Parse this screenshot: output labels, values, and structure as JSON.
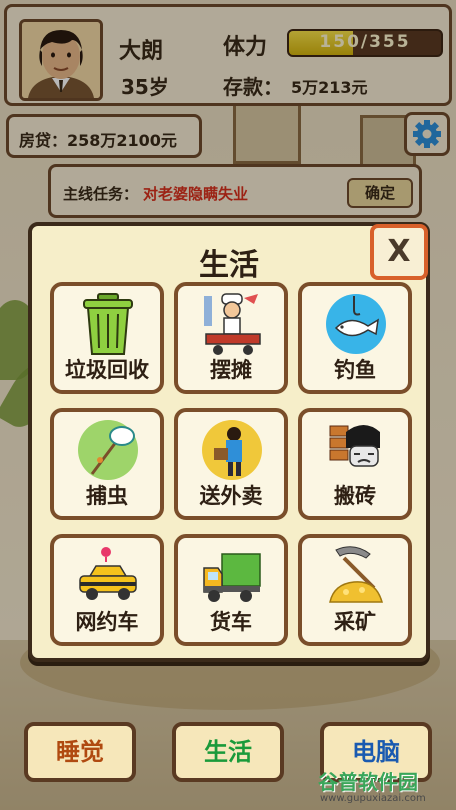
{
  "player": {
    "name": "大朗",
    "age": "35岁",
    "stamina_label": "体力",
    "stamina": "150/355",
    "stamina_fraction": 0.42,
    "savings_label": "存款：",
    "savings": "5万213元",
    "loan": "房贷：258万2100元"
  },
  "mission": {
    "label": "主线任务：",
    "text": "对老婆隐瞒失业",
    "confirm": "确定"
  },
  "panel": {
    "title": "生活",
    "close": "X",
    "items": [
      {
        "label": "垃圾回收",
        "icon": "trash-can-icon"
      },
      {
        "label": "摆摊",
        "icon": "street-vendor-icon"
      },
      {
        "label": "钓鱼",
        "icon": "fish-hook-icon"
      },
      {
        "label": "捕虫",
        "icon": "bug-net-icon"
      },
      {
        "label": "送外卖",
        "icon": "delivery-man-icon"
      },
      {
        "label": "搬砖",
        "icon": "brick-carrier-icon"
      },
      {
        "label": "网约车",
        "icon": "taxi-icon"
      },
      {
        "label": "货车",
        "icon": "truck-icon"
      },
      {
        "label": "采矿",
        "icon": "pickaxe-gold-icon"
      }
    ]
  },
  "nav": {
    "sleep": "睡觉",
    "life": "生活",
    "computer": "电脑"
  },
  "watermark": {
    "main": "谷普软件园",
    "sub": "www.gupuxiazai.com"
  },
  "colors": {
    "accent_red": "#d8301c",
    "stamina_yellow": "#e6c81c",
    "frame_brown": "#6e4a2c"
  }
}
